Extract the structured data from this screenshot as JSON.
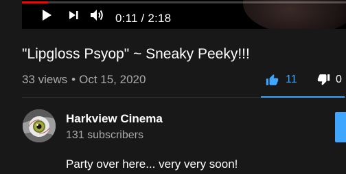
{
  "player": {
    "time_display": "0:11 / 2:18",
    "progress": 0.08,
    "played_color": "#ff0000",
    "icons": {
      "play": "play-icon",
      "next": "next-icon",
      "volume": "volume-icon"
    }
  },
  "video": {
    "title": "\"Lipgloss Psyop\" ~ Sneaky Peeky!!!",
    "views": "33 views",
    "separator": "•",
    "date": "Oct 15, 2020"
  },
  "sentiment": {
    "like_count": "11",
    "dislike_count": "0",
    "like_icon": "thumbs-up-icon",
    "dislike_icon": "thumbs-down-icon",
    "accent_color": "#3ea6ff"
  },
  "channel": {
    "name": "Harkview Cinema",
    "subscribers": "131 subscribers",
    "avatar_icon": "eye-avatar"
  },
  "description": {
    "text": "Party over here... very very soon!"
  }
}
